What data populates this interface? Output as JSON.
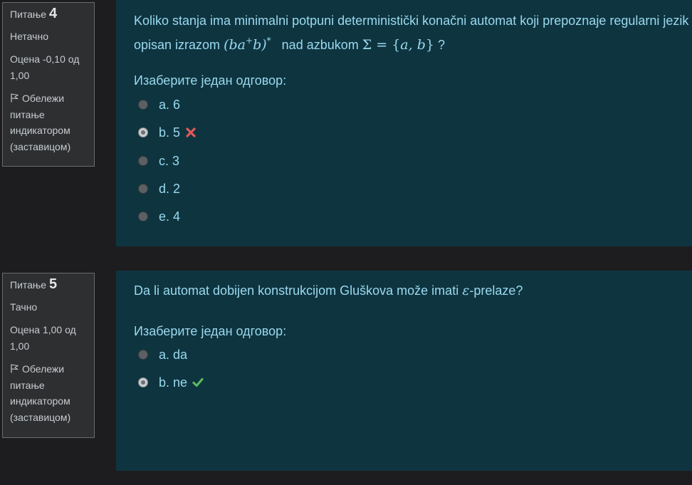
{
  "questions": [
    {
      "label": "Питање",
      "number": "4",
      "state": "Нетачно",
      "grade": "Оцена -0,10 од 1,00",
      "flag_label": "Обележи питање индикатором (заставицом)",
      "text_before": "Koliko stanja ima minimalni potpuni deterministički konačni automat koji prepoznaje regularni jezik opisan izrazom",
      "math_expr": "(ba⁺b)*",
      "text_middle": "nad azbukom",
      "math_alphabet": "Σ = {a, b}",
      "text_after": "?",
      "prompt": "Изаберите један одговор:",
      "answers": [
        {
          "letter": "a.",
          "text": "6",
          "checked": false,
          "mark": ""
        },
        {
          "letter": "b.",
          "text": "5",
          "checked": true,
          "mark": "incorrect"
        },
        {
          "letter": "c.",
          "text": "3",
          "checked": false,
          "mark": ""
        },
        {
          "letter": "d.",
          "text": "2",
          "checked": false,
          "mark": ""
        },
        {
          "letter": "e.",
          "text": "4",
          "checked": false,
          "mark": ""
        }
      ]
    },
    {
      "label": "Питање",
      "number": "5",
      "state": "Тачно",
      "grade": "Оцена 1,00 од 1,00",
      "flag_label": "Обележи питање индикатором (заставицом)",
      "text_before": "Da li automat dobijen konstrukcijom Gluškova može imati",
      "math_epsilon": "ε",
      "text_after": "-prelaze?",
      "prompt": "Изаберите један одговор:",
      "answers": [
        {
          "letter": "a.",
          "text": "da",
          "checked": false,
          "mark": ""
        },
        {
          "letter": "b.",
          "text": "ne",
          "checked": true,
          "mark": "correct"
        }
      ]
    }
  ],
  "colors": {
    "page_bg": "#1d1d1f",
    "info_bg": "#2d2f31",
    "content_bg": "#0e3440",
    "text": "#9ad9ee",
    "incorrect": "#e05a5a",
    "correct": "#5cb85c"
  },
  "icons": {
    "flag": "flag-icon",
    "incorrect": "cross-icon",
    "correct": "check-icon"
  }
}
